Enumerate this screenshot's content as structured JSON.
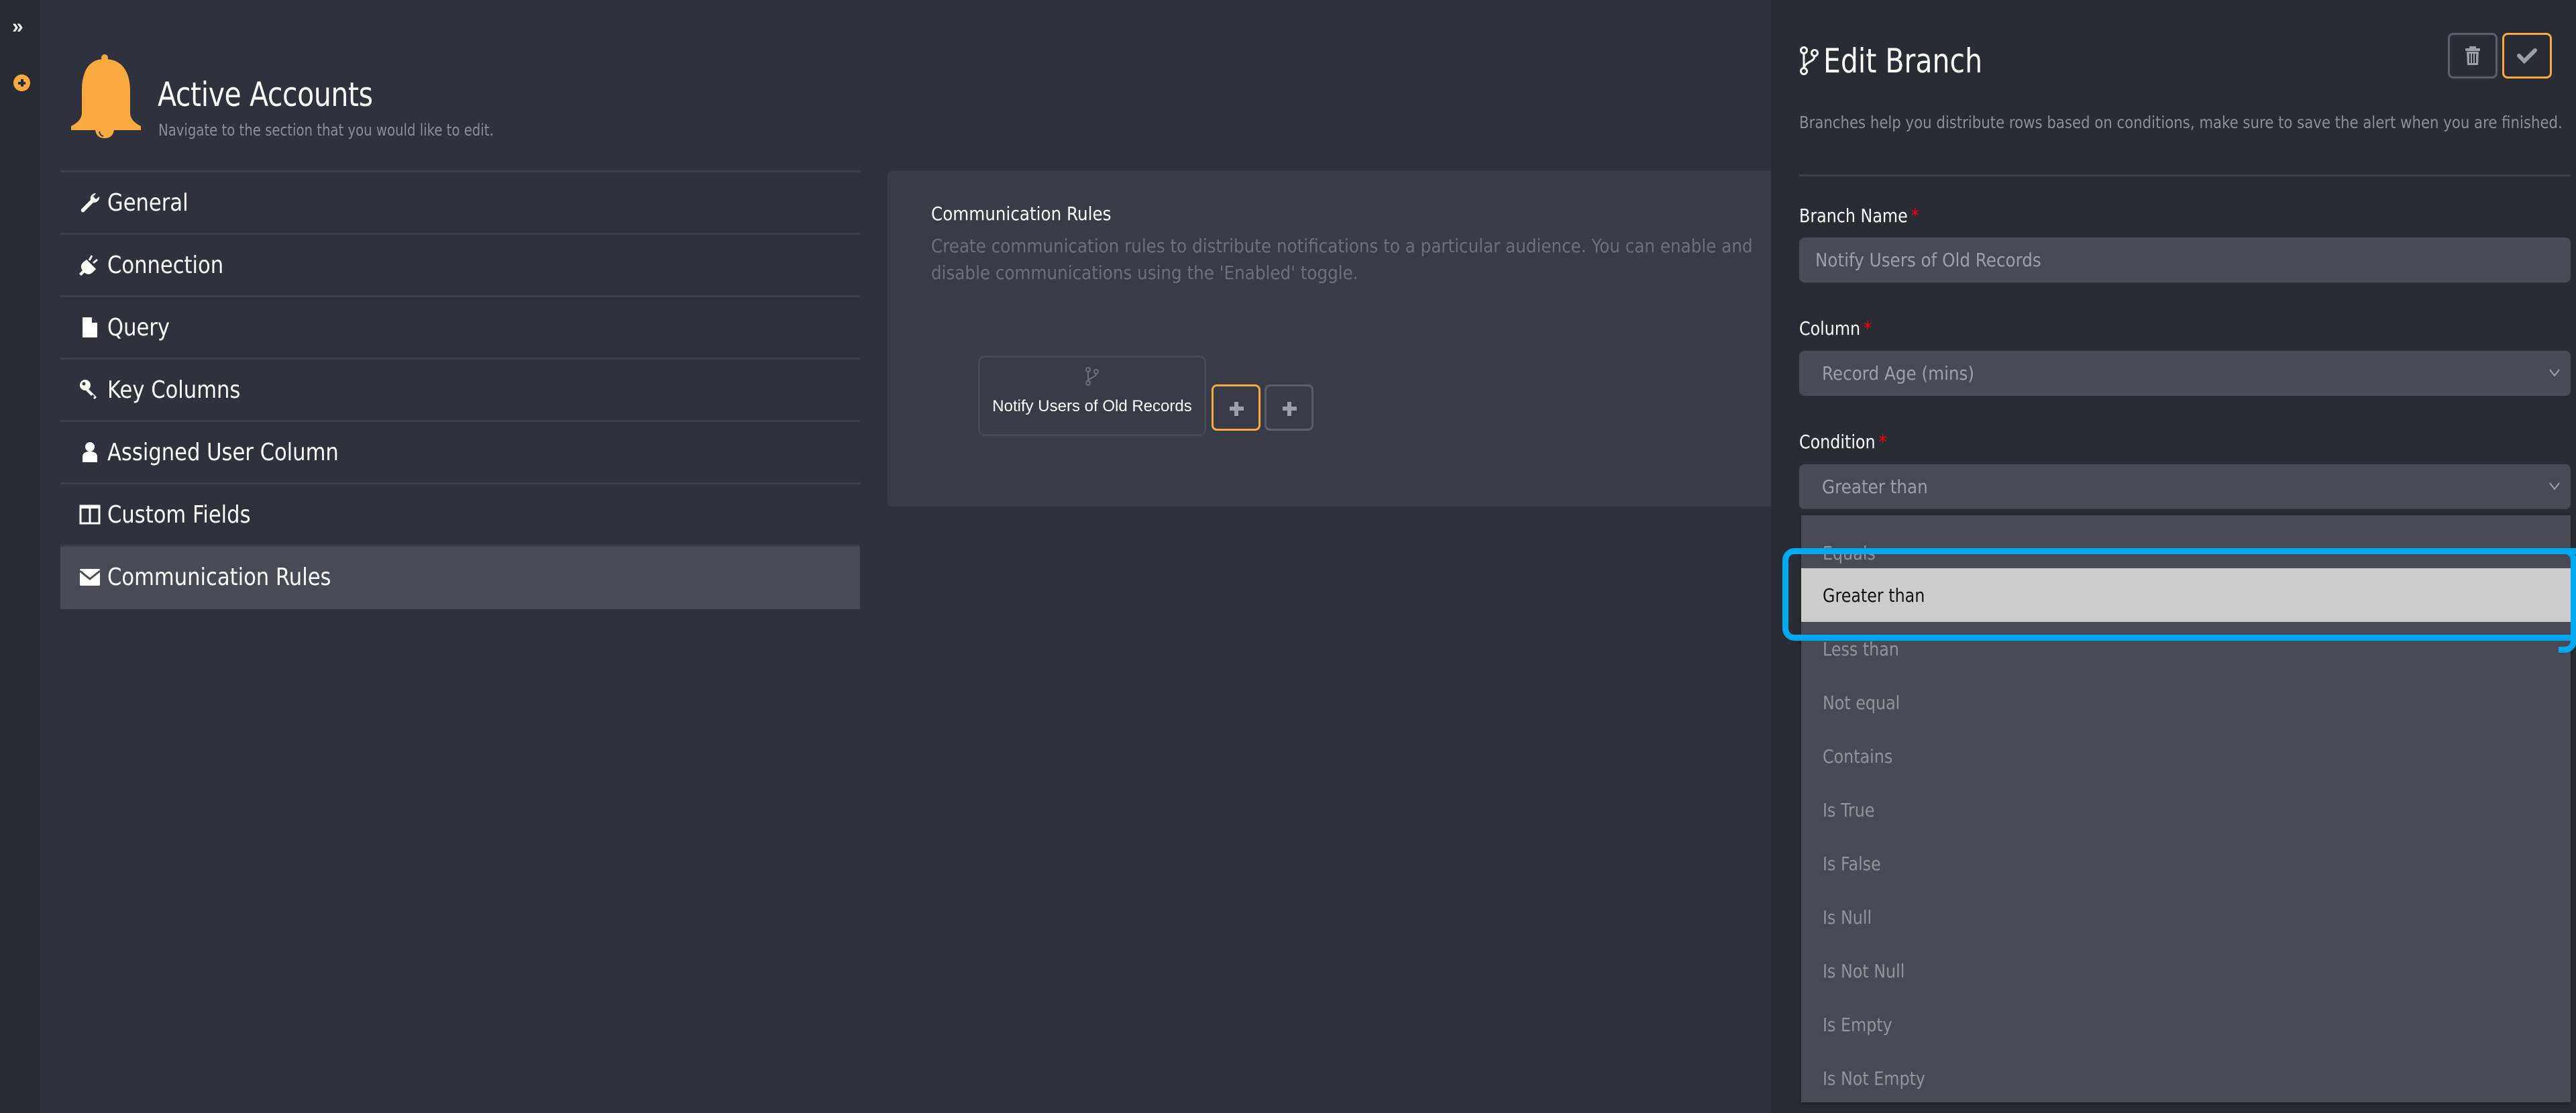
{
  "rail": {
    "expand_icon": "double-chevron-right-icon",
    "add_icon": "plus-circle-icon"
  },
  "header": {
    "icon": "bell-icon",
    "title": "Active Accounts",
    "subtitle": "Navigate to the section that you would like to edit."
  },
  "nav": {
    "items": [
      {
        "label": "General",
        "icon": "wrench-icon",
        "active": false
      },
      {
        "label": "Connection",
        "icon": "plug-icon",
        "active": false
      },
      {
        "label": "Query",
        "icon": "file-icon",
        "active": false
      },
      {
        "label": "Key Columns",
        "icon": "key-icon",
        "active": false
      },
      {
        "label": "Assigned User Column",
        "icon": "user-icon",
        "active": false
      },
      {
        "label": "Custom Fields",
        "icon": "columns-icon",
        "active": false
      },
      {
        "label": "Communication Rules",
        "icon": "envelope-icon",
        "active": true
      }
    ]
  },
  "main": {
    "title": "Communication Rules",
    "description": "Create communication rules to distribute notifications to a particular audience. You can enable and disable communications using the 'Enabled' toggle.",
    "branch_node": {
      "icon": "branch-icon",
      "label": "Notify Users of Old Records"
    },
    "add_buttons": [
      {
        "icon": "plus-icon",
        "style": "primary"
      },
      {
        "icon": "plus-icon",
        "style": "secondary"
      }
    ]
  },
  "edit_branch": {
    "title": "Edit Branch",
    "title_icon": "branch-icon",
    "delete_icon": "trash-icon",
    "save_icon": "check-icon",
    "description": "Branches help you distribute rows based on conditions, make sure to save the alert when you are finished.",
    "fields": {
      "branch_name": {
        "label": "Branch Name",
        "required_mark": "*",
        "value": "Notify Users of Old Records"
      },
      "column": {
        "label": "Column",
        "required_mark": "*",
        "value": "Record Age (mins)"
      },
      "condition": {
        "label": "Condition",
        "required_mark": "*",
        "value": "Greater than"
      }
    },
    "condition_options": [
      "Equals",
      "Greater than",
      "Less than",
      "Not equal",
      "Contains",
      "Is True",
      "Is False",
      "Is Null",
      "Is Not Null",
      "Is Empty",
      "Is Not Empty"
    ],
    "selected_option": "Greater than"
  },
  "colors": {
    "accent": "#f9a940",
    "annotation": "#00a8f0",
    "background": "#2f323c",
    "panel": "#393b46",
    "required": "#ff0000"
  }
}
